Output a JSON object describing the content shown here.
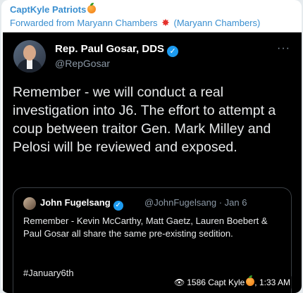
{
  "message": {
    "channel": "CaptKyle Patriots",
    "forwarded": {
      "prefix": "Forwarded from Maryann Chambers",
      "suffix": "(Maryann Chambers)"
    },
    "views": "1586",
    "author_signature": "Capt Kyle",
    "time": ", 1:33 AM"
  },
  "tweet": {
    "author": "Rep. Paul Gosar, DDS",
    "handle": "@RepGosar",
    "text": "Remember - we will conduct a real investigation into J6. The effort to attempt a coup between traitor Gen. Mark Milley and Pelosi will be reviewed and exposed.",
    "more": "···",
    "quote": {
      "author": "John Fugelsang",
      "handle_date": "@JohnFugelsang · Jan 6",
      "text": "Remember - Kevin McCarthy, Matt Gaetz, Lauren Boebert & Paul Gosar all share the same pre-existing sedition.",
      "hashtag": "#January6th"
    }
  },
  "icons": {
    "verified": "verified-check-icon",
    "views": "eye-icon",
    "emoji_orange": "tangerine-emoji",
    "emoji_burst": "collision-emoji"
  },
  "colors": {
    "channel_blue": "#3a8fd0",
    "tweet_bg": "#000000",
    "verified_blue": "#1d9bf0",
    "muted_gray": "#8b98a5"
  }
}
